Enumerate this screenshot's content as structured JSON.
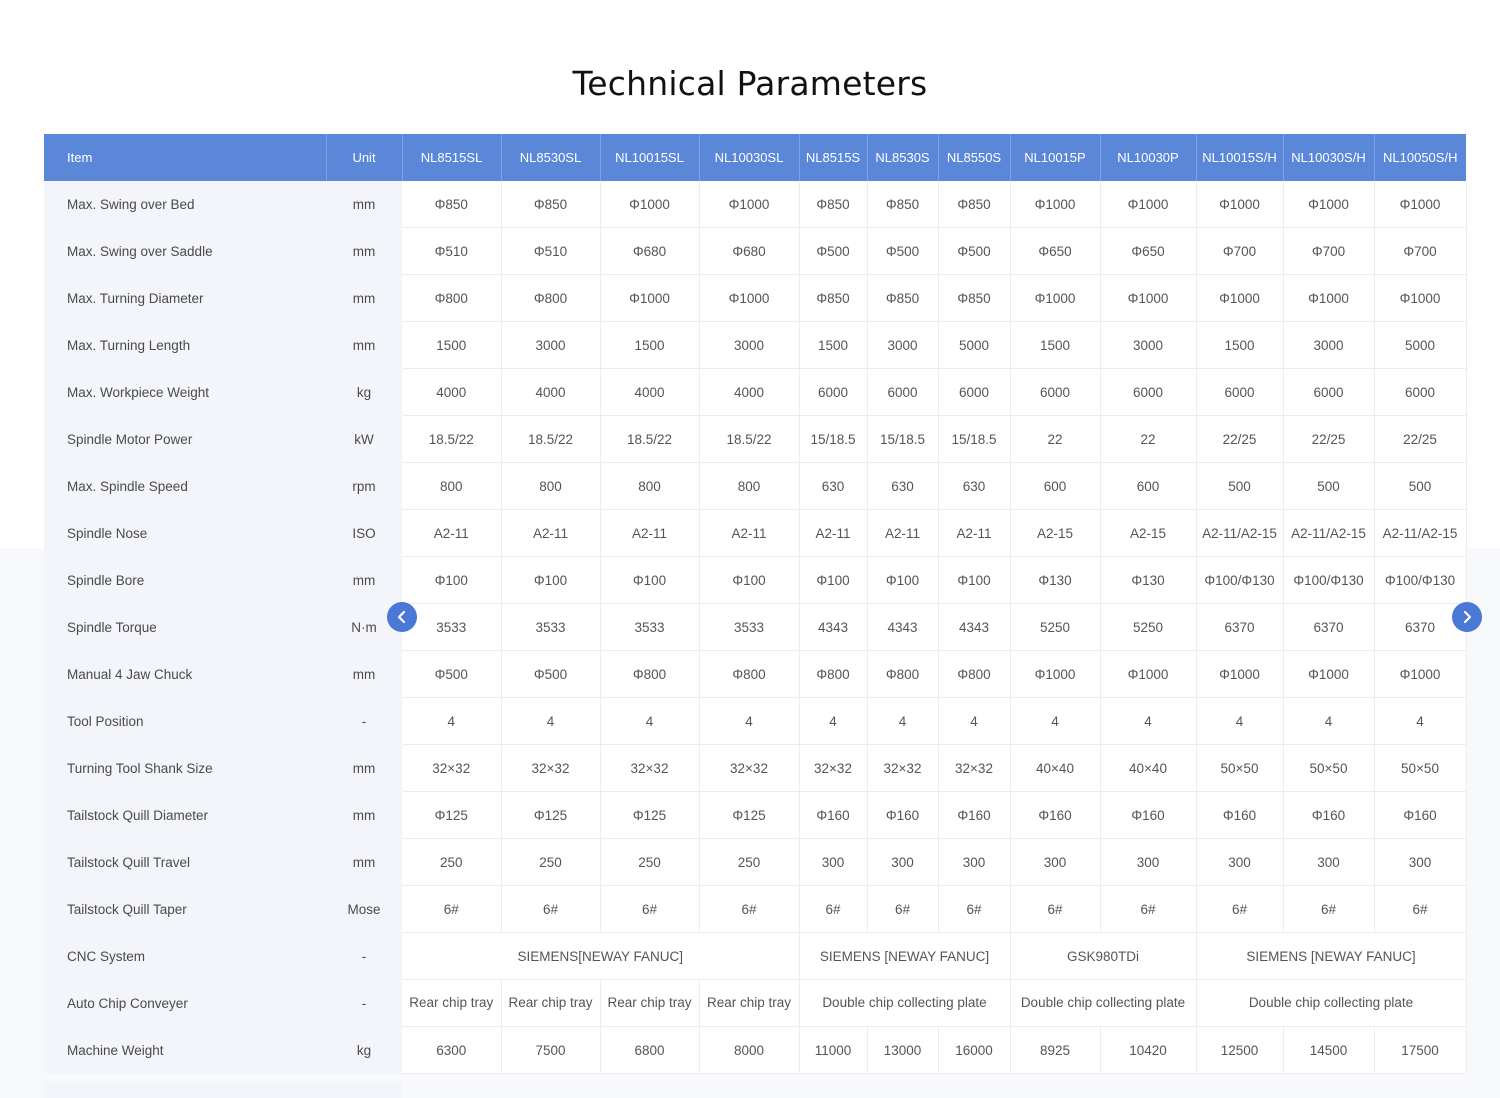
{
  "page": {
    "title": "Technical Parameters"
  },
  "table": {
    "headers": [
      "Item",
      "Unit",
      "NL8515SL",
      "NL8530SL",
      "NL10015SL",
      "NL10030SL",
      "NL8515S",
      "NL8530S",
      "NL8550S",
      "NL10015P",
      "NL10030P",
      "NL10015S/H",
      "NL10030S/H",
      "NL10050S/H"
    ],
    "rows": [
      {
        "cells": [
          "Max. Swing  over Bed",
          "mm",
          "Φ850",
          "Φ850",
          "Φ1000",
          "Φ1000",
          "Φ850",
          "Φ850",
          "Φ850",
          "Φ1000",
          "Φ1000",
          "Φ1000",
          "Φ1000",
          "Φ1000"
        ]
      },
      {
        "cells": [
          "Max. Swing  over Saddle",
          "mm",
          "Φ510",
          "Φ510",
          "Φ680",
          "Φ680",
          "Φ500",
          "Φ500",
          "Φ500",
          "Φ650",
          "Φ650",
          "Φ700",
          "Φ700",
          "Φ700"
        ]
      },
      {
        "cells": [
          "Max. Turning  Diameter",
          "mm",
          "Φ800",
          "Φ800",
          "Φ1000",
          "Φ1000",
          "Φ850",
          "Φ850",
          "Φ850",
          "Φ1000",
          "Φ1000",
          "Φ1000",
          "Φ1000",
          "Φ1000"
        ]
      },
      {
        "cells": [
          "Max. Turning  Length",
          "mm",
          "1500",
          "3000",
          "1500",
          "3000",
          "1500",
          "3000",
          "5000",
          "1500",
          "3000",
          "1500",
          "3000",
          "5000"
        ]
      },
      {
        "cells": [
          "Max.  Workpiece Weight",
          "kg",
          "4000",
          "4000",
          "4000",
          "4000",
          "6000",
          "6000",
          "6000",
          "6000",
          "6000",
          "6000",
          "6000",
          "6000"
        ]
      },
      {
        "cells": [
          "Spindle Motor  Power",
          "kW",
          "18.5/22",
          "18.5/22",
          "18.5/22",
          "18.5/22",
          "15/18.5",
          "15/18.5",
          "15/18.5",
          "22",
          "22",
          "22/25",
          "22/25",
          "22/25"
        ]
      },
      {
        "cells": [
          "Max. Spindle Speed",
          "rpm",
          "800",
          "800",
          "800",
          "800",
          "630",
          "630",
          "630",
          "600",
          "600",
          "500",
          "500",
          "500"
        ]
      },
      {
        "cells": [
          "Spindle Nose",
          "ISO",
          "A2-11",
          "A2-11",
          "A2-11",
          "A2-11",
          "A2-11",
          "A2-11",
          "A2-11",
          "A2-15",
          "A2-15",
          "A2-11/A2-15",
          "A2-11/A2-15",
          "A2-11/A2-15"
        ]
      },
      {
        "cells": [
          "Spindle Bore",
          "mm",
          "Φ100",
          "Φ100",
          "Φ100",
          "Φ100",
          "Φ100",
          "Φ100",
          "Φ100",
          "Φ130",
          "Φ130",
          "Φ100/Φ130",
          "Φ100/Φ130",
          "Φ100/Φ130"
        ]
      },
      {
        "cells": [
          "Spindle  Torque",
          "N·m",
          "3533",
          "3533",
          "3533",
          "3533",
          "4343",
          "4343",
          "4343",
          "5250",
          "5250",
          "6370",
          "6370",
          "6370"
        ]
      },
      {
        "cells": [
          "Manual 4 Jaw Chuck",
          "mm",
          "Φ500",
          "Φ500",
          "Φ800",
          "Φ800",
          "Φ800",
          "Φ800",
          "Φ800",
          "Φ1000",
          "Φ1000",
          "Φ1000",
          "Φ1000",
          "Φ1000"
        ]
      },
      {
        "cells": [
          "Tool Position",
          "-",
          "4",
          "4",
          "4",
          "4",
          "4",
          "4",
          "4",
          "4",
          "4",
          "4",
          "4",
          "4"
        ]
      },
      {
        "cells": [
          "Turning Tool  Shank Size",
          "mm",
          "32×32",
          "32×32",
          "32×32",
          "32×32",
          "32×32",
          "32×32",
          "32×32",
          "40×40",
          "40×40",
          "50×50",
          "50×50",
          "50×50"
        ]
      },
      {
        "cells": [
          "Tailstock  Quill Diameter",
          "mm",
          "Φ125",
          "Φ125",
          "Φ125",
          "Φ125",
          "Φ160",
          "Φ160",
          "Φ160",
          "Φ160",
          "Φ160",
          "Φ160",
          "Φ160",
          "Φ160"
        ]
      },
      {
        "cells": [
          "Tailstock Quill Travel",
          "mm",
          "250",
          "250",
          "250",
          "250",
          "300",
          "300",
          "300",
          "300",
          "300",
          "300",
          "300",
          "300"
        ]
      },
      {
        "cells": [
          "Tailstock  Quill Taper",
          "Mose",
          "6#",
          "6#",
          "6#",
          "6#",
          "6#",
          "6#",
          "6#",
          "6#",
          "6#",
          "6#",
          "6#",
          "6#"
        ]
      },
      {
        "cells": [
          "CNC System",
          "-",
          "SIEMENS[NEWAY  FANUC]",
          "SIEMENS [NEWAY FANUC]",
          "GSK980TDi",
          "SIEMENS [NEWAY FANUC]"
        ],
        "spans": [
          1,
          1,
          4,
          3,
          2,
          3
        ]
      },
      {
        "cells": [
          "Auto Chip  Conveyer",
          "-",
          "Rear chip tray",
          "Rear chip tray",
          "Rear chip tray",
          "Rear chip tray",
          "Double chip collecting  plate",
          "Double chip collecting plate",
          "Double chip collecting  plate"
        ],
        "spans": [
          1,
          1,
          1,
          1,
          1,
          1,
          3,
          2,
          3
        ]
      },
      {
        "cells": [
          "Machine  Weight",
          "kg",
          "6300",
          "7500",
          "6800",
          "8000",
          "11000",
          "13000",
          "16000",
          "8925",
          "10420",
          "12500",
          "14500",
          "17500"
        ]
      }
    ]
  },
  "nav": {
    "prev_icon": "chevron-left-icon",
    "next_icon": "chevron-right-icon"
  }
}
